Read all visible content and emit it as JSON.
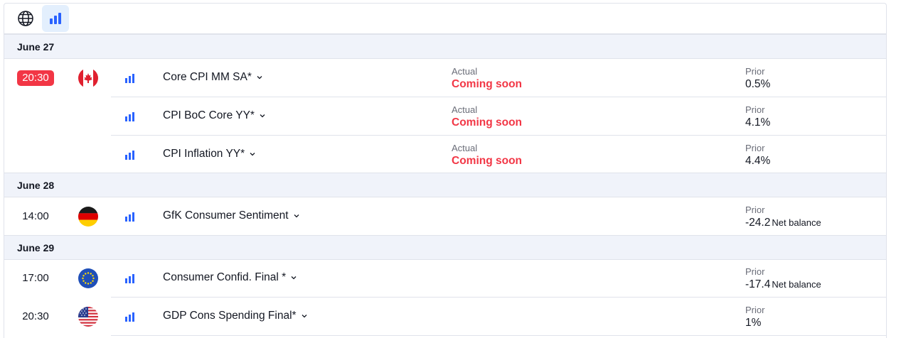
{
  "toolbar": {
    "globe_icon": "globe-icon",
    "chart_icon": "bar-chart-icon"
  },
  "colors": {
    "accent_blue": "#2962ff",
    "live_red": "#f23645",
    "date_bg": "#f0f3fa"
  },
  "labels": {
    "actual": "Actual",
    "prior": "Prior"
  },
  "groups": [
    {
      "date": "June 27",
      "events": [
        {
          "time": "20:30",
          "live": true,
          "flag": "canada-flag",
          "name": "Core CPI MM SA*",
          "actual": "Coming soon",
          "prior": "0.5%",
          "unit": ""
        },
        {
          "time": "",
          "flag": "",
          "name": "CPI BoC Core YY*",
          "actual": "Coming soon",
          "prior": "4.1%",
          "unit": ""
        },
        {
          "time": "",
          "flag": "",
          "name": "CPI Inflation YY*",
          "actual": "Coming soon",
          "prior": "4.4%",
          "unit": ""
        }
      ]
    },
    {
      "date": "June 28",
      "events": [
        {
          "time": "14:00",
          "flag": "germany-flag",
          "name": "GfK Consumer Sentiment",
          "actual": "",
          "prior": "-24.2",
          "unit": "Net balance"
        }
      ]
    },
    {
      "date": "June 29",
      "events": [
        {
          "time": "17:00",
          "flag": "eu-flag",
          "name": "Consumer Confid. Final *",
          "actual": "",
          "prior": "-17.4",
          "unit": "Net balance"
        },
        {
          "time": "20:30",
          "flag": "usa-flag",
          "name": "GDP Cons Spending Final*",
          "actual": "",
          "prior": "1%",
          "unit": ""
        }
      ]
    }
  ]
}
